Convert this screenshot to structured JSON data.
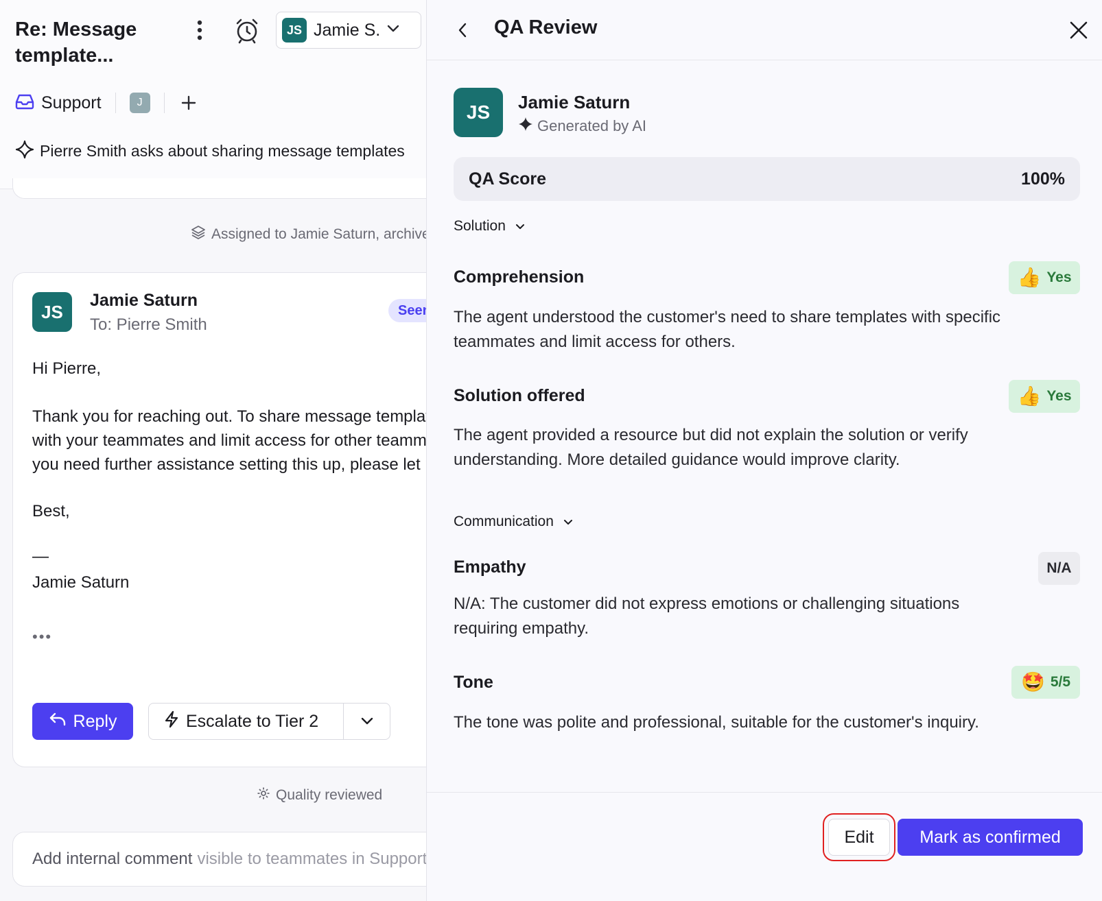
{
  "conversation": {
    "title": "Re: Message template...",
    "assignee": {
      "initials": "JS",
      "name": "Jamie S."
    },
    "inbox": "Support",
    "teammate_badge": "J",
    "summary": "Pierre Smith asks about sharing message templates",
    "assigned_event": "Assigned to Jamie Saturn, archived",
    "message": {
      "sender_initials": "JS",
      "sender": "Jamie Saturn",
      "recipient": "To: Pierre Smith",
      "status": "Seen",
      "greeting": "Hi Pierre,",
      "body_line1": "Thank you for reaching out. To share message templates",
      "body_line2": "with your teammates and limit access for other teammates,",
      "body_line3": "you need further assistance setting this up, please let me know.",
      "signoff": "Best,",
      "signature_dash": "—",
      "signature_name": "Jamie Saturn",
      "more": "•••"
    },
    "reply_label": "Reply",
    "escalate_label": "Escalate to Tier 2",
    "quality_event": "Quality reviewed",
    "comment_placeholder_a": "Add internal comment",
    "comment_placeholder_b": "visible to teammates in Support"
  },
  "qa_panel": {
    "title": "QA Review",
    "reviewer": {
      "initials": "JS",
      "name": "Jamie Saturn",
      "subtitle": "Generated by AI"
    },
    "score_label": "QA Score",
    "score_value": "100%",
    "sections": [
      {
        "name": "Solution",
        "criteria": [
          {
            "title": "Comprehension",
            "badge_emoji": "👍",
            "badge_text": "Yes",
            "desc_line1": "The agent understood the customer's need to share templates with specific",
            "desc_line2": "teammates and limit access for others."
          },
          {
            "title": "Solution offered",
            "badge_emoji": "👍",
            "badge_text": "Yes",
            "desc_line1": "The agent provided a resource but did not explain the solution or verify",
            "desc_line2": "understanding. More detailed guidance would improve clarity."
          }
        ]
      },
      {
        "name": "Communication",
        "criteria": [
          {
            "title": "Empathy",
            "badge_text": "N/A",
            "desc_line1": "N/A: The customer did not express emotions or challenging situations",
            "desc_line2": "requiring empathy."
          },
          {
            "title": "Tone",
            "badge_emoji": "🤩",
            "badge_text": "5/5",
            "desc_line1": "The tone was polite and professional, suitable for the customer's inquiry."
          }
        ]
      }
    ],
    "edit_label": "Edit",
    "confirm_label": "Mark as confirmed"
  },
  "colors": {
    "accent": "#4c3ff0",
    "avatar": "#19706f",
    "yes_bg": "#d8f2df",
    "yes_text": "#2a7a3b",
    "highlight": "#e02020"
  }
}
